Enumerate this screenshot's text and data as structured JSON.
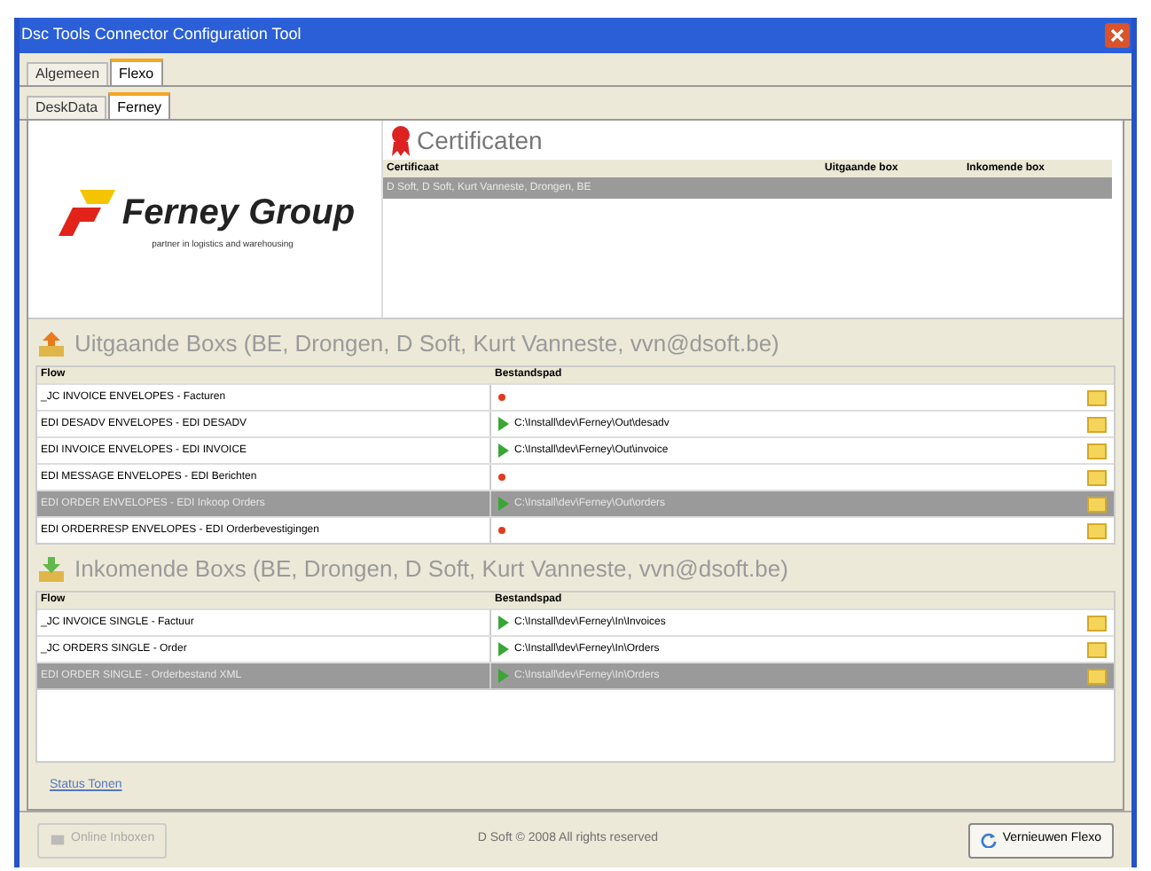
{
  "window": {
    "title": "Dsc Tools Connector Configuration Tool"
  },
  "tabs": [
    {
      "label": "Algemeen",
      "selected": false
    },
    {
      "label": "Flexo",
      "selected": true
    }
  ],
  "sub_tabs": [
    {
      "label": "DeskData",
      "selected": false
    },
    {
      "label": "Ferney",
      "selected": true
    }
  ],
  "logo": {
    "name": "Ferney Group",
    "tagline": "partner in logistics and warehousing"
  },
  "certificates": {
    "title": "Certificaten",
    "columns": [
      "Certificaat",
      "Uitgaande box",
      "Inkomende box"
    ],
    "rows": [
      {
        "cells": [
          "D Soft, D Soft, Kurt Vanneste, Drongen, BE",
          "",
          ""
        ],
        "selected": true
      }
    ]
  },
  "outgoing": {
    "title": "Uitgaande Boxs (BE, Drongen, D Soft, Kurt Vanneste, vvn@dsoft.be)",
    "columns": [
      "Flow",
      "Bestandspad"
    ],
    "rows": [
      {
        "flow": "_JC INVOICE ENVELOPES - Facturen",
        "ok": false,
        "path": "",
        "selected": false
      },
      {
        "flow": "EDI DESADV ENVELOPES - EDI DESADV",
        "ok": true,
        "path": "C:\\Install\\dev\\Ferney\\Out\\desadv",
        "selected": false
      },
      {
        "flow": "EDI INVOICE ENVELOPES - EDI INVOICE",
        "ok": true,
        "path": "C:\\Install\\dev\\Ferney\\Out\\invoice",
        "selected": false
      },
      {
        "flow": "EDI MESSAGE ENVELOPES - EDI Berichten",
        "ok": false,
        "path": "",
        "selected": false
      },
      {
        "flow": "EDI ORDER ENVELOPES - EDI Inkoop Orders",
        "ok": true,
        "path": "C:\\Install\\dev\\Ferney\\Out\\orders",
        "selected": true
      },
      {
        "flow": "EDI ORDERRESP ENVELOPES - EDI Orderbevestigingen",
        "ok": false,
        "path": "",
        "selected": false
      }
    ]
  },
  "incoming": {
    "title": "Inkomende Boxs (BE, Drongen, D Soft, Kurt Vanneste, vvn@dsoft.be)",
    "columns": [
      "Flow",
      "Bestandspad"
    ],
    "rows": [
      {
        "flow": "_JC INVOICE SINGLE - Factuur",
        "ok": true,
        "path": "C:\\Install\\dev\\Ferney\\In\\Invoices",
        "selected": false
      },
      {
        "flow": "_JC ORDERS SINGLE - Order",
        "ok": true,
        "path": "C:\\Install\\dev\\Ferney\\In\\Orders",
        "selected": false
      },
      {
        "flow": "EDI ORDER SINGLE - Orderbestand XML",
        "ok": true,
        "path": "C:\\Install\\dev\\Ferney\\In\\Orders",
        "selected": true
      }
    ]
  },
  "status_link": "Status Tonen",
  "footer": {
    "left_button": {
      "label": "Online Inboxen",
      "disabled": true
    },
    "copyright": "D Soft © 2008 All rights reserved",
    "right_button": {
      "label": "Vernieuwen Flexo",
      "disabled": false
    }
  }
}
